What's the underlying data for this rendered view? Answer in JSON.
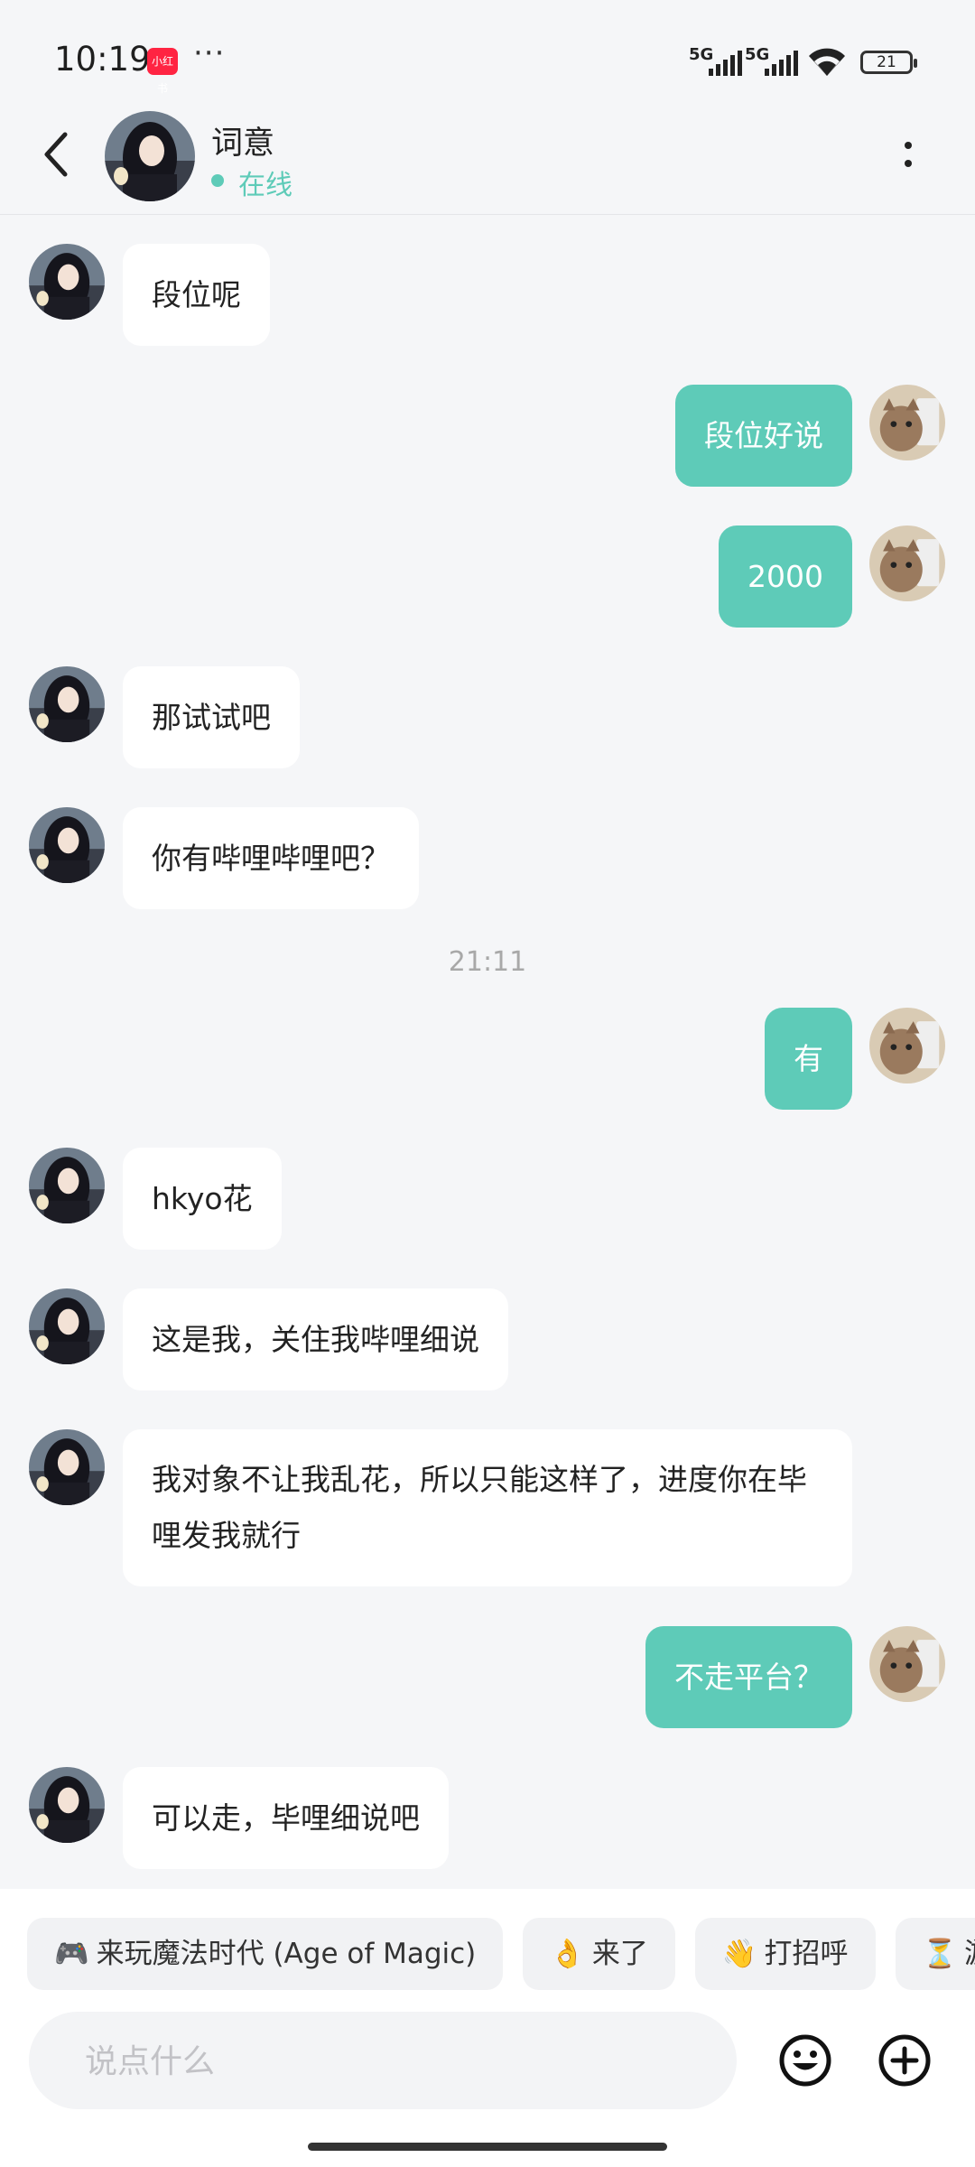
{
  "status": {
    "time": "10:19",
    "app_badge": "小红书",
    "more": "···",
    "signal1": "5G",
    "signal2": "5G",
    "battery": "21"
  },
  "header": {
    "name": "词意",
    "status": "在线"
  },
  "messages": [
    {
      "from": "other",
      "text": "段位呢"
    },
    {
      "from": "me",
      "text": "段位好说"
    },
    {
      "from": "me",
      "text": "2000"
    },
    {
      "from": "other",
      "text": "那试试吧"
    },
    {
      "from": "other",
      "text": "你有哔哩哔哩吧？"
    },
    {
      "from": "me",
      "text": "有"
    },
    {
      "from": "other",
      "text": "hkyo花"
    },
    {
      "from": "other",
      "text": "这是我，关住我哔哩细说"
    },
    {
      "from": "other",
      "text": "我对象不让我乱花，所以只能这样了，进度你在毕哩发我就行"
    },
    {
      "from": "me",
      "text": "不走平台？"
    },
    {
      "from": "other",
      "text": "可以走，毕哩细说吧"
    }
  ],
  "timestamp": "21:11",
  "quick_replies": [
    {
      "emoji": "🎮",
      "text": "来玩魔法时代 (Age of Magic)"
    },
    {
      "emoji": "👌",
      "text": "来了"
    },
    {
      "emoji": "👋",
      "text": "打招呼"
    },
    {
      "emoji": "⏳",
      "text": "游"
    }
  ],
  "composer": {
    "placeholder": "说点什么"
  },
  "colors": {
    "accent": "#5ecbb8",
    "background": "#f5f6f8"
  }
}
